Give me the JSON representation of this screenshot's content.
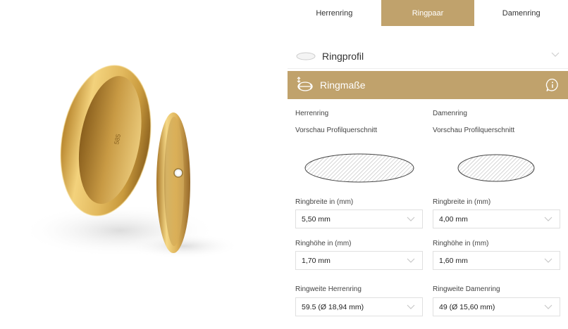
{
  "tabs": [
    {
      "label": "Herrenring",
      "active": false
    },
    {
      "label": "Ringpaar",
      "active": true
    },
    {
      "label": "Damenring",
      "active": false
    }
  ],
  "ringprofil": {
    "label": "Ringprofil",
    "icon": "oval-icon"
  },
  "ringmasse": {
    "label": "Ringmaße",
    "icon": "resize-arrows-icon",
    "info_icon": "info-icon"
  },
  "herren": {
    "heading": "Herrenring",
    "preview_label": "Vorschau Profilquerschnitt",
    "breite_label": "Ringbreite in (mm)",
    "breite_value": "5,50 mm",
    "hoehe_label": "Ringhöhe in (mm)",
    "hoehe_value": "1,70 mm",
    "weite_label": "Ringweite Herrenring",
    "weite_value": "59.5 (Ø 18,94 mm)"
  },
  "damen": {
    "heading": "Damenring",
    "preview_label": "Vorschau Profilquerschnitt",
    "breite_label": "Ringbreite in (mm)",
    "breite_value": "4,00 mm",
    "hoehe_label": "Ringhöhe in (mm)",
    "hoehe_value": "1,60 mm",
    "weite_label": "Ringweite Damenring",
    "weite_value": "49 (Ø 15,60 mm)"
  },
  "ring_engraving": "585",
  "colors": {
    "accent": "#c0a26c",
    "gold": "#d8b25a"
  }
}
